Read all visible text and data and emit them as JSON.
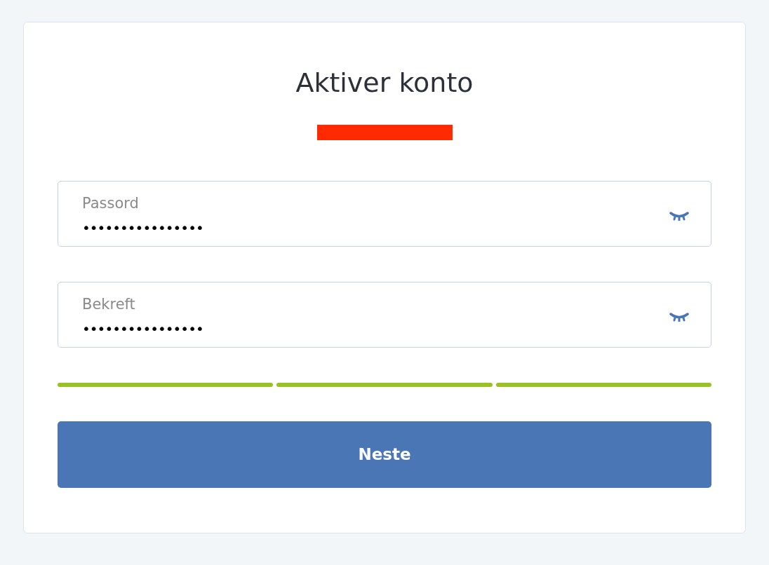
{
  "title": "Aktiver konto",
  "subtitle": {
    "redacted": true
  },
  "fields": [
    {
      "label": "Passord",
      "value": "••••••••••••••••",
      "revealed": false
    },
    {
      "label": "Bekreft",
      "value": "••••••••••••••••",
      "revealed": false
    }
  ],
  "strength_meter": [
    {
      "on": true
    },
    {
      "on": true
    },
    {
      "on": true
    }
  ],
  "button": "Neste"
}
